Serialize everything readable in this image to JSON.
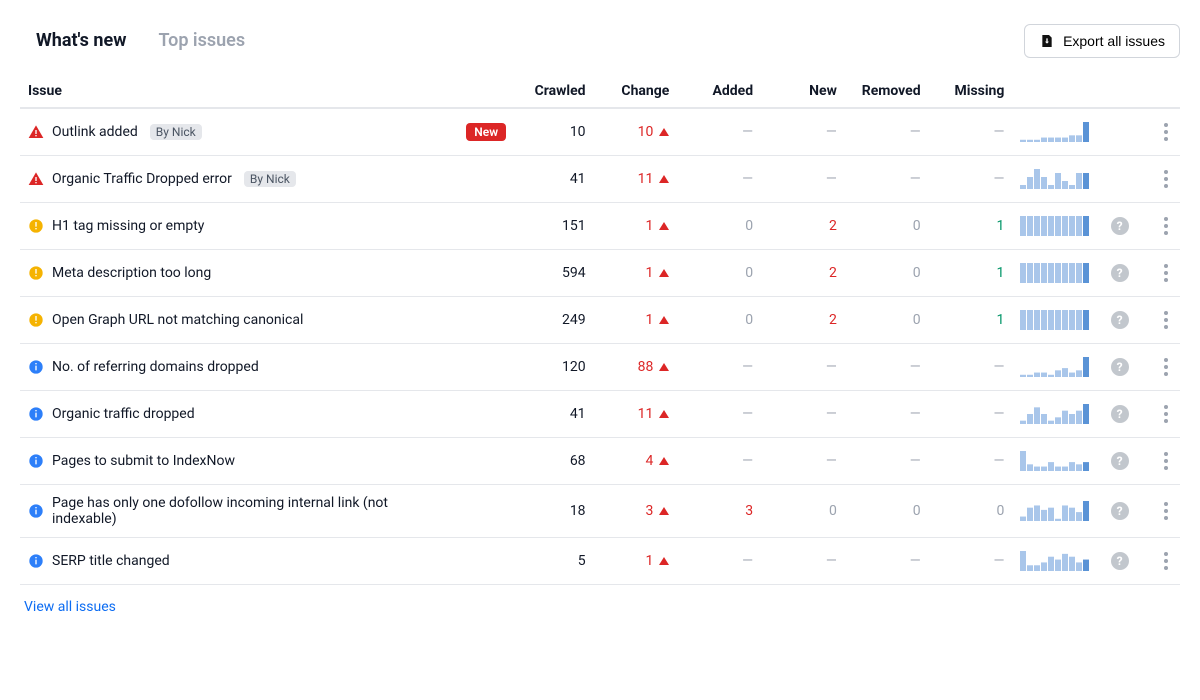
{
  "tabs": {
    "whats_new": "What's new",
    "top_issues": "Top issues"
  },
  "export_label": "Export all issues",
  "columns": {
    "issue": "Issue",
    "crawled": "Crawled",
    "change": "Change",
    "added": "Added",
    "new": "New",
    "removed": "Removed",
    "missing": "Missing"
  },
  "by_label": "By Nick",
  "new_badge": "New",
  "view_all": "View all issues",
  "rows": [
    {
      "severity": "error",
      "name": "Outlink added",
      "by": true,
      "badge": "new",
      "crawled": "10",
      "change": "10",
      "added": "—",
      "new": "—",
      "removed": "—",
      "missing": "—",
      "help": false,
      "spark": [
        1,
        1,
        1,
        2,
        2,
        2,
        2,
        3,
        3,
        9
      ]
    },
    {
      "severity": "error",
      "name": "Organic Traffic Dropped error",
      "by": true,
      "badge": null,
      "crawled": "41",
      "change": "11",
      "added": "—",
      "new": "—",
      "removed": "—",
      "missing": "—",
      "help": false,
      "spark": [
        1,
        3,
        5,
        3,
        1,
        4,
        2,
        1,
        4,
        4
      ]
    },
    {
      "severity": "warning",
      "name": "H1 tag missing or empty",
      "by": false,
      "badge": null,
      "crawled": "151",
      "change": "1",
      "added": "0",
      "new": "2",
      "removed": "0",
      "missing": "1",
      "help": true,
      "spark": [
        9,
        9,
        9,
        9,
        9,
        9,
        9,
        9,
        9,
        9
      ]
    },
    {
      "severity": "warning",
      "name": "Meta description too long",
      "by": false,
      "badge": null,
      "crawled": "594",
      "change": "1",
      "added": "0",
      "new": "2",
      "removed": "0",
      "missing": "1",
      "help": true,
      "spark": [
        9,
        9,
        9,
        9,
        9,
        9,
        9,
        9,
        9,
        9
      ]
    },
    {
      "severity": "warning",
      "name": "Open Graph URL not matching canonical",
      "by": false,
      "badge": null,
      "crawled": "249",
      "change": "1",
      "added": "0",
      "new": "2",
      "removed": "0",
      "missing": "1",
      "help": true,
      "spark": [
        9,
        9,
        9,
        9,
        9,
        9,
        9,
        9,
        9,
        9
      ]
    },
    {
      "severity": "info",
      "name": "No. of referring domains dropped",
      "by": false,
      "badge": null,
      "crawled": "120",
      "change": "88",
      "added": "—",
      "new": "—",
      "removed": "—",
      "missing": "—",
      "help": true,
      "spark": [
        1,
        1,
        2,
        2,
        1,
        3,
        4,
        2,
        3,
        9
      ]
    },
    {
      "severity": "info",
      "name": "Organic traffic dropped",
      "by": false,
      "badge": null,
      "crawled": "41",
      "change": "11",
      "added": "—",
      "new": "—",
      "removed": "—",
      "missing": "—",
      "help": true,
      "spark": [
        1,
        3,
        5,
        3,
        1,
        2,
        4,
        3,
        4,
        6
      ]
    },
    {
      "severity": "info",
      "name": "Pages to submit to IndexNow",
      "by": false,
      "badge": null,
      "crawled": "68",
      "change": "4",
      "added": "—",
      "new": "—",
      "removed": "—",
      "missing": "—",
      "help": true,
      "spark": [
        9,
        3,
        2,
        2,
        4,
        2,
        2,
        4,
        3,
        4
      ]
    },
    {
      "severity": "info",
      "name": "Page has only one dofollow incoming internal link (not indexable)",
      "by": false,
      "badge": null,
      "crawled": "18",
      "change": "3",
      "added": "3",
      "new": "0",
      "removed": "0",
      "missing": "0",
      "help": true,
      "spark": [
        2,
        6,
        7,
        5,
        6,
        1,
        7,
        6,
        4,
        9
      ]
    },
    {
      "severity": "info",
      "name": "SERP title changed",
      "by": false,
      "badge": null,
      "crawled": "5",
      "change": "1",
      "added": "—",
      "new": "—",
      "removed": "—",
      "missing": "—",
      "help": true,
      "spark": [
        7,
        2,
        2,
        3,
        5,
        4,
        6,
        5,
        3,
        4
      ]
    }
  ]
}
